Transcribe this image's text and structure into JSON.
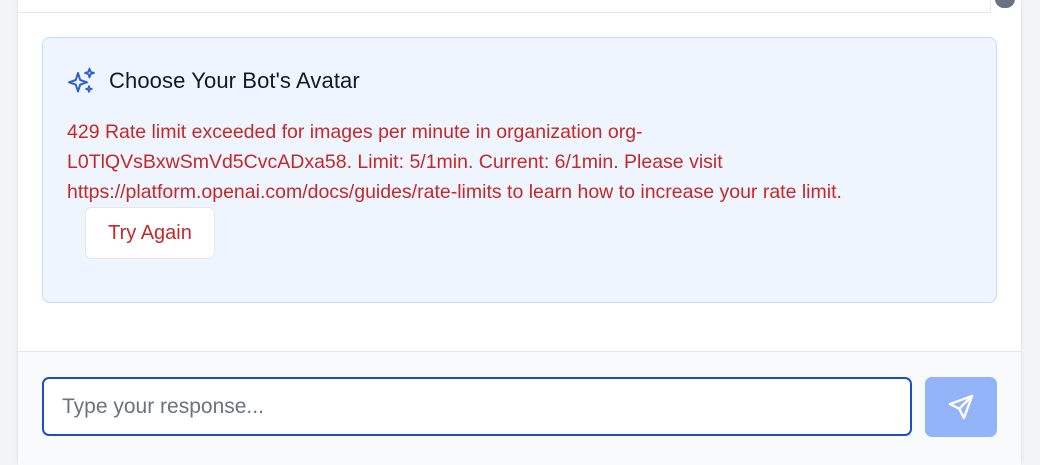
{
  "avatar_card": {
    "title": "Choose Your Bot's Avatar",
    "icon": "sparkles-icon",
    "error_message": "429 Rate limit exceeded for images per minute in organization org-\nL0TlQVsBxwSmVd5CvcADxa58. Limit: 5/1min. Current: 6/1min. Please visit\nhttps://platform.openai.com/docs/guides/rate-limits to learn how to increase your rate limit.",
    "retry_label": "Try Again"
  },
  "composer": {
    "placeholder": "Type your response...",
    "value": "",
    "send_icon": "send-icon"
  },
  "colors": {
    "accent": "#2f5fd0",
    "error": "#c62828",
    "card_bg": "#eef5fe",
    "card_border": "#bfdbfe",
    "send_button_bg": "#93b4f8"
  }
}
